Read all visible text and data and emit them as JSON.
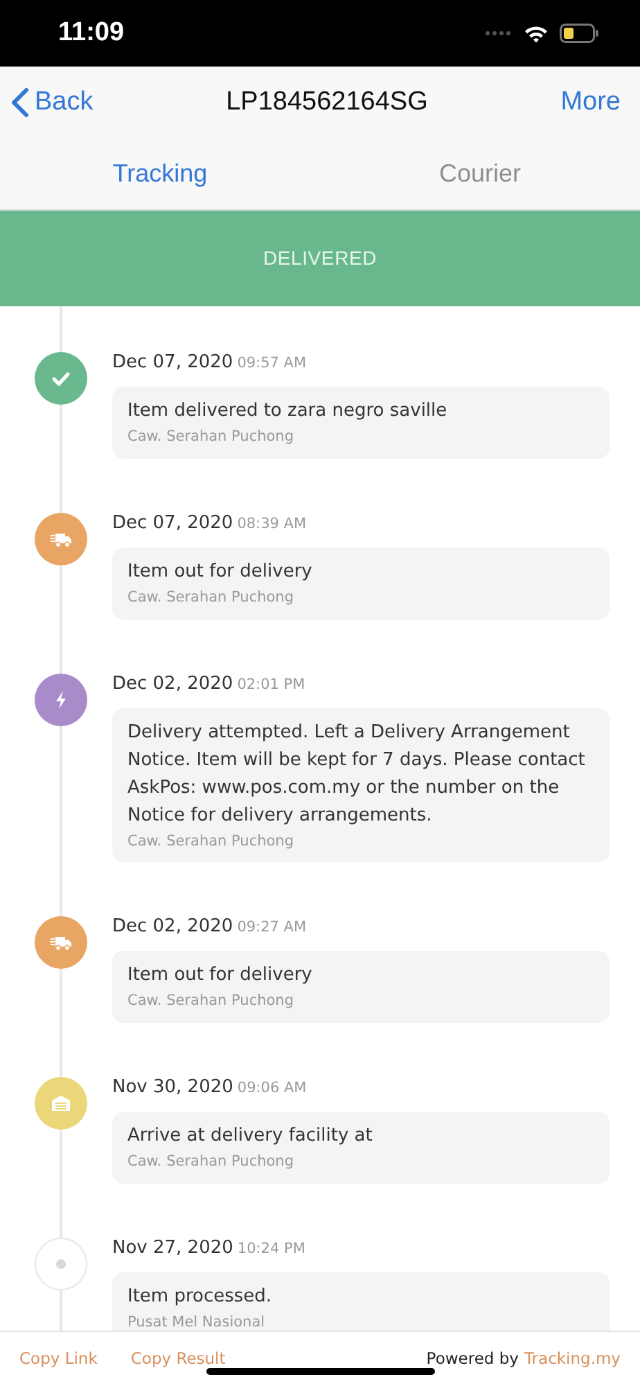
{
  "status_bar": {
    "time": "11:09"
  },
  "nav": {
    "back": "Back",
    "title": "LP184562164SG",
    "more": "More"
  },
  "tabs": [
    {
      "label": "Tracking",
      "selected": true
    },
    {
      "label": "Courier",
      "selected": false
    }
  ],
  "banner": {
    "status": "DELIVERED"
  },
  "events": [
    {
      "kind": "delivered",
      "date": "Dec 07, 2020",
      "time": "09:57 AM",
      "text": "Item delivered to zara negro saville",
      "location": "Caw. Serahan Puchong"
    },
    {
      "kind": "out",
      "date": "Dec 07, 2020",
      "time": "08:39 AM",
      "text": "Item out for delivery",
      "location": "Caw. Serahan Puchong"
    },
    {
      "kind": "attempt",
      "date": "Dec 02, 2020",
      "time": "02:01 PM",
      "text": "Delivery attempted. Left a Delivery Arrangement Notice. Item will be kept for 7 days. Please contact AskPos: www.pos.com.my or the number on the Notice for delivery arrangements.",
      "location": "Caw. Serahan Puchong"
    },
    {
      "kind": "out",
      "date": "Dec 02, 2020",
      "time": "09:27 AM",
      "text": "Item out for delivery",
      "location": "Caw. Serahan Puchong"
    },
    {
      "kind": "facility",
      "date": "Nov 30, 2020",
      "time": "09:06 AM",
      "text": "Arrive at delivery facility at",
      "location": "Caw. Serahan Puchong"
    },
    {
      "kind": "info",
      "date": "Nov 27, 2020",
      "time": "10:24 PM",
      "text": "Item processed.",
      "location": "Pusat Mel Nasional"
    }
  ],
  "footer": {
    "copy_link": "Copy Link",
    "copy_result": "Copy Result",
    "powered_by": "Powered by",
    "site": "Tracking.my"
  }
}
